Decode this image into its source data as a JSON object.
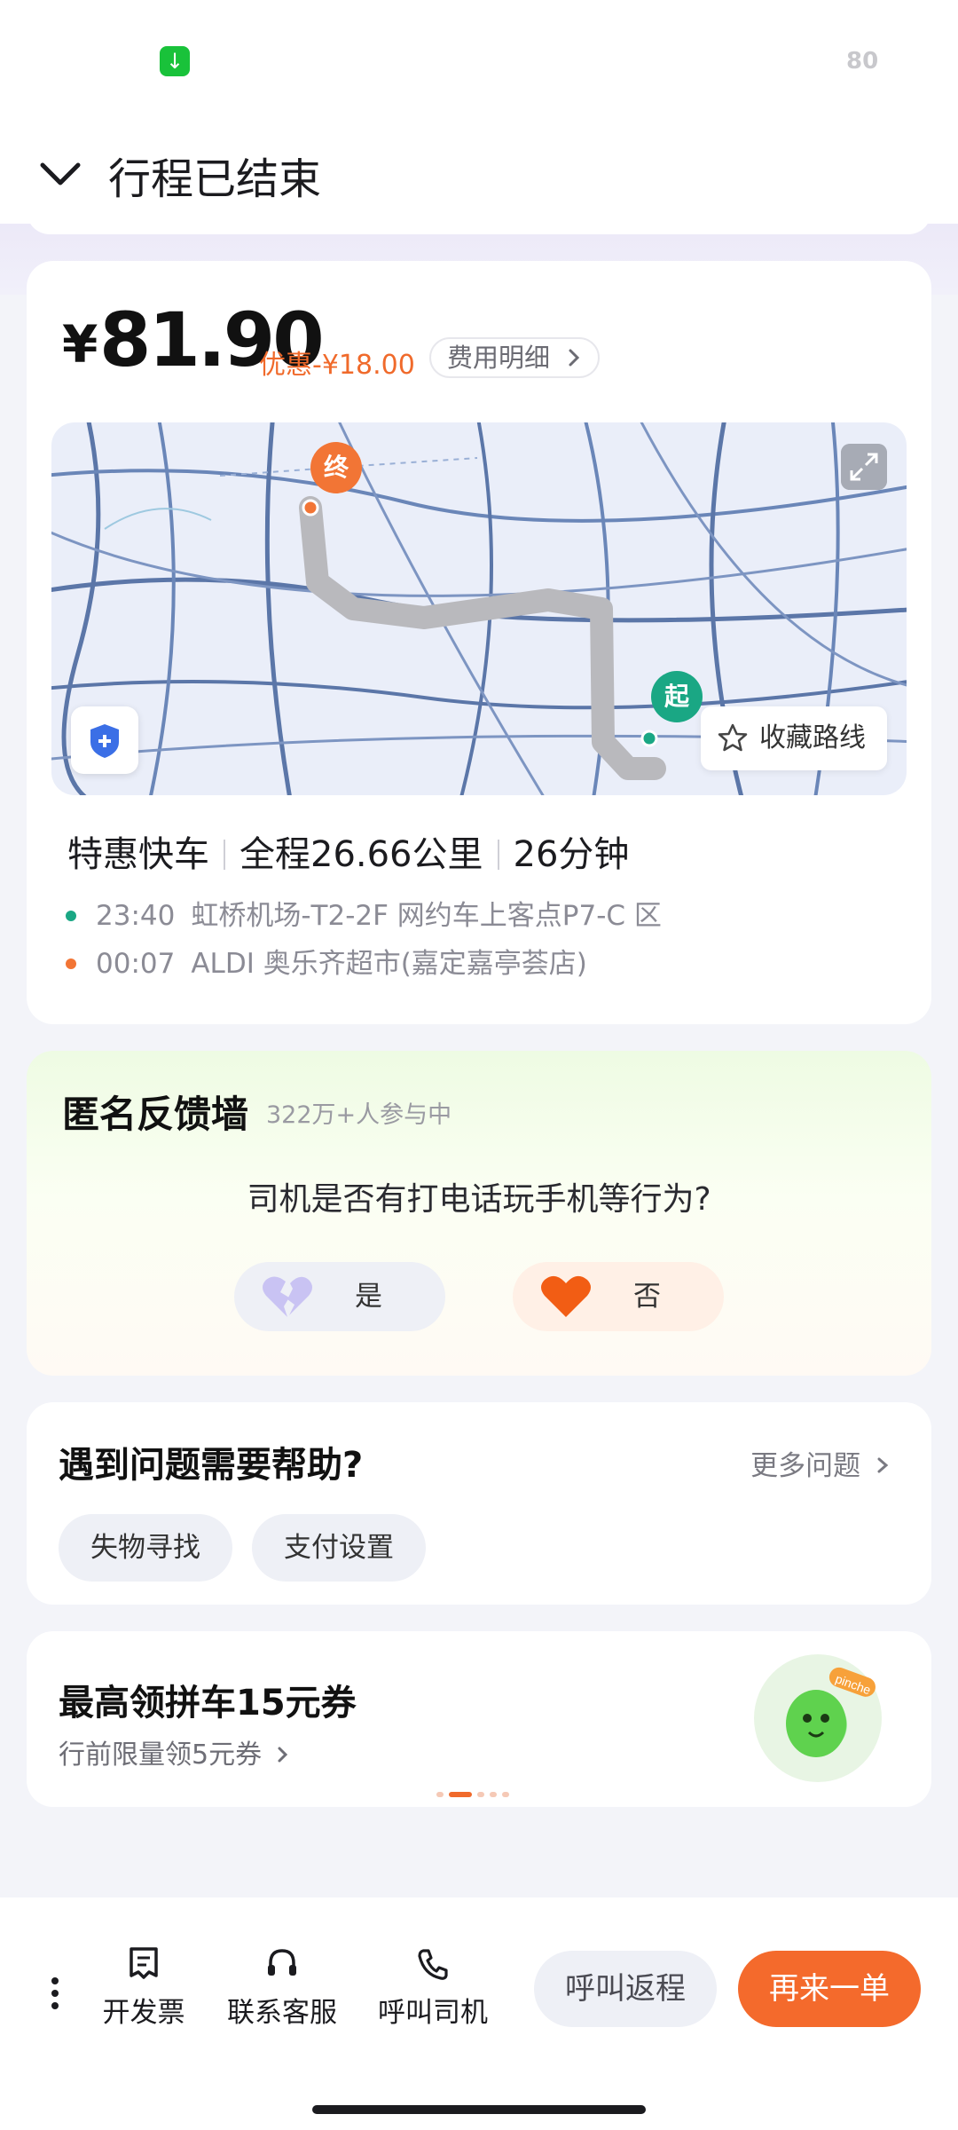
{
  "status_bar": {
    "battery": "80",
    "download_icon": "download-arrow-icon"
  },
  "header": {
    "title": "行程已结束",
    "back_icon": "chevron-down-icon"
  },
  "trip": {
    "price_currency": "¥",
    "price": "81.90",
    "discount": "优惠-¥18.00",
    "fee_detail_label": "费用明细",
    "map": {
      "end_marker": "终",
      "start_marker": "起",
      "favorite_route_label": "收藏路线"
    },
    "service": "特惠快车",
    "distance": "全程26.66公里",
    "duration": "26分钟",
    "stops": [
      {
        "time": "23:40",
        "place": "虹桥机场-T2-2F 网约车上客点P7-C 区",
        "color": "#1aa784"
      },
      {
        "time": "00:07",
        "place": "ALDI 奥乐齐超市(嘉定嘉亭荟店)",
        "color": "#f27535"
      }
    ]
  },
  "feedback": {
    "title": "匿名反馈墙",
    "participants": "322万+人参与中",
    "question": "司机是否有打电话玩手机等行为?",
    "yes_label": "是",
    "no_label": "否"
  },
  "help": {
    "title": "遇到问题需要帮助?",
    "more_label": "更多问题",
    "chips": [
      "失物寻找",
      "支付设置"
    ]
  },
  "promo": {
    "title": "最高领拼车15元券",
    "subtitle": "行前限量领5元券",
    "badge_text": "pinche",
    "carousel_total": 5,
    "carousel_active": 1
  },
  "bottom_bar": {
    "invoice_label": "开发票",
    "service_label": "联系客服",
    "call_driver_label": "呼叫司机",
    "return_label": "呼叫返程",
    "again_label": "再来一单"
  },
  "colors": {
    "accent": "#f46a2c",
    "start_green": "#1aa784",
    "end_orange": "#f27535"
  }
}
